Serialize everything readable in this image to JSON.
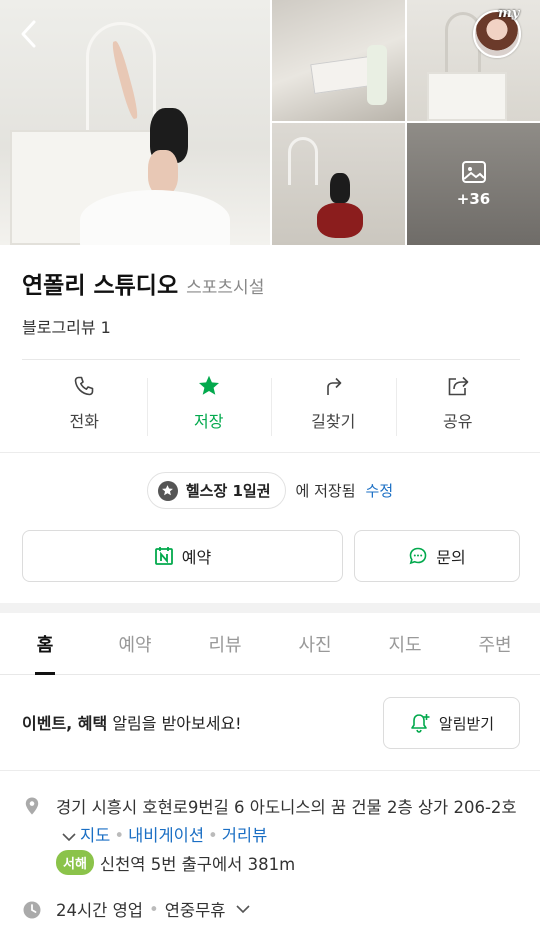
{
  "header": {
    "back_icon": "chevron-left-icon",
    "profile_tag": "my",
    "more_photos_count": "+36"
  },
  "place": {
    "name": "연폴리 스튜디오",
    "category": "스포츠시설",
    "review_text": "블로그리뷰 1"
  },
  "actions": [
    {
      "label": "전화",
      "icon": "phone-icon"
    },
    {
      "label": "저장",
      "icon": "star-icon",
      "color": "#03a94d"
    },
    {
      "label": "길찾기",
      "icon": "directions-icon"
    },
    {
      "label": "공유",
      "icon": "share-icon"
    }
  ],
  "saved": {
    "folder": "헬스장 1일권",
    "suffix": "에 저장됨",
    "edit": "수정"
  },
  "buttons": {
    "reserve": "예약",
    "inquiry": "문의"
  },
  "tabs": [
    "홈",
    "예약",
    "리뷰",
    "사진",
    "지도",
    "주변"
  ],
  "alert": {
    "bold": "이벤트, 혜택",
    "rest": " 알림을 받아보세요!",
    "button": "알림받기"
  },
  "info": {
    "address": "경기 시흥시 호현로9번길 6 아도니스의 꿈 건물 2층 상가 206-2호",
    "map_link": "지도",
    "nav_link": "내비게이션",
    "street_link": "거리뷰",
    "subway_line": "서해",
    "subway_text": "신천역 5번 출구에서 381m",
    "hours": "24시간 영업",
    "holiday": "연중무휴"
  },
  "colors": {
    "accent_green": "#03a94d",
    "link_blue": "#1b6fc4",
    "subway_badge": "#8bc34a"
  }
}
